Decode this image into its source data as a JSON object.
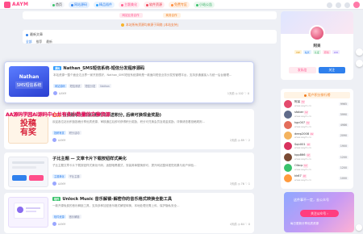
{
  "brand": {
    "name": "AAYM",
    "accent": "#ff3d7f"
  },
  "nav": [
    {
      "label": "首页",
      "color": "#f5f7fb",
      "dot": "#3cc36c",
      "text": "#444"
    },
    {
      "label": "网站源码",
      "color": "#e5f1ff",
      "dot": "#2f80ed",
      "text": "#2f80ed"
    },
    {
      "label": "精品插件",
      "color": "#e9f4ff",
      "dot": "#2fa3ff",
      "text": "#2f80ed"
    },
    {
      "label": "主题美化",
      "color": "#fff0f4",
      "dot": "#ff5b8d",
      "text": "#ff4f8b"
    },
    {
      "label": "软件资源",
      "color": "#ffecef",
      "dot": "#f24b5e",
      "text": "#e8384c"
    },
    {
      "label": "免费专区",
      "color": "#fff1e6",
      "dot": "#ff8b3d",
      "text": "#f07a1a"
    },
    {
      "label": "小站公告",
      "color": "#eaf8ef",
      "dot": "#39c26c",
      "text": "#2daa5c"
    }
  ],
  "notice": {
    "buttons": [
      {
        "label": "网站业务合作",
        "bg": "#ffe9ef",
        "fg": "#ff4f8b"
      },
      {
        "label": "商务合作",
        "bg": "#fff2e3",
        "fg": "#f07a1a"
      }
    ],
    "warning": "本站所有资源均来源于网络 [本站支持]"
  },
  "latest": {
    "title": "最新文章",
    "tabs": [
      "全部",
      "推荐",
      "最新"
    ]
  },
  "overlay_text": "AA源码学园Ai源码中心共有多少数量的文章资源",
  "posts": [
    {
      "thumb_text": [
        "Nathan",
        "SMS短信系统"
      ],
      "category": "源码",
      "title": "Nathan_SMS短信系统-短信分发程序源码",
      "desc": "本站资源一整个面全达业界一家开放很好，Nathan_SMS短信系统源码是一款面向短信业务分发的管理平台，支持多通道接入与统一后台管理…",
      "tags": [
        "网站源码",
        "短信系统",
        "短信分发",
        "Nathan"
      ],
      "author": "AAYM",
      "stats": "1天前  ◷ 102  ♡ 0"
    },
    {
      "thumb_text": [
        "投稿",
        "有奖"
      ],
      "category": "公告",
      "title": "投稿赚积分资源(更新资源送积分, 后续可换现金奖励)",
      "desc": "欢迎各位站长积极投稿分享优质资源，审核通过后即可获得积分奖励，积分可兑换会员及现金奖励，详情请查看投稿规则…",
      "tags": [
        "投稿有奖",
        "积分活动"
      ],
      "author": "AAYM",
      "stats": "2天前  ◷ 89  ♡ 2"
    },
    {
      "thumb_text": [],
      "category": "",
      "title": "子比主题 — 文章卡片下载按钮样式美化",
      "desc": "子比主题文章卡片下载按钮样式美化代码，适配暗黑模式，安装简单替换即可，提升网站整体视觉效果与用户体验…",
      "tags": [
        "主题美化",
        "子比主题"
      ],
      "author": "AAYM",
      "stats": "3天前  ◷ 76  ♡ 1"
    },
    {
      "thumb_text": [],
      "category": "软件",
      "title": "Unlock Music 音乐解锁-解密你的音乐格式转换全能工具",
      "desc": "一款开源免费的音乐解锁工具，支持多种加密音乐格式解密转换，本地处理无需上传，保护隐私安全…",
      "tags": [
        "软件资源",
        "音乐解锁"
      ],
      "author": "AAYM",
      "stats": "4天前  ◷ 64  ♡ 0"
    }
  ],
  "profile": {
    "name": "阿呆",
    "badges": [
      {
        "label": "VIP",
        "bg": "#fff3d6",
        "fg": "#d68a00"
      },
      {
        "label": "站长",
        "bg": "#e5f1ff",
        "fg": "#2f80ed"
      },
      {
        "label": "认证",
        "bg": "#eaf8ef",
        "fg": "#2daa5c"
      },
      {
        "label": "原创",
        "bg": "#ffe9ef",
        "fg": "#ff4f8b"
      },
      {
        "label": "LV6",
        "bg": "#f1ecff",
        "fg": "#7b5cf0"
      }
    ],
    "btn_primary": "发私信",
    "btn_secondary": "关注"
  },
  "ranking": {
    "title": "用户积分排行榜",
    "users": [
      {
        "name": "阿呆",
        "sub": "www.aaym.cn",
        "value": "9965",
        "color": "#e44a6d"
      },
      {
        "name": "sfaber",
        "sub": "www.aaym.cn",
        "value": "5990",
        "color": "#5f6b8a"
      },
      {
        "name": "kgc007",
        "sub": "www.aaym.cn",
        "value": "4986",
        "color": "#e36d5b"
      },
      {
        "name": "deep2008",
        "sub": "www.aaym.cn",
        "value": "2090",
        "color": "#f4b35e"
      },
      {
        "name": "Sqn001",
        "sub": "www.aaym.cn",
        "value": "1900",
        "color": "#d8325e"
      },
      {
        "name": "kpp866",
        "sub": "www.aaym.cn",
        "value": "1200",
        "color": "#7a4a33"
      },
      {
        "name": "Olbcp",
        "sub": "www.aaym.cn",
        "value": "1200",
        "color": "#39c26c"
      },
      {
        "name": "kk67",
        "sub": "www.aaym.cn",
        "value": "1000",
        "color": "#ff9a3d"
      }
    ]
  },
  "promo": {
    "line1": "这件事不一定，去公众号",
    "button": "关注公众号 ›",
    "line2": "每日更新分享优质资源"
  }
}
